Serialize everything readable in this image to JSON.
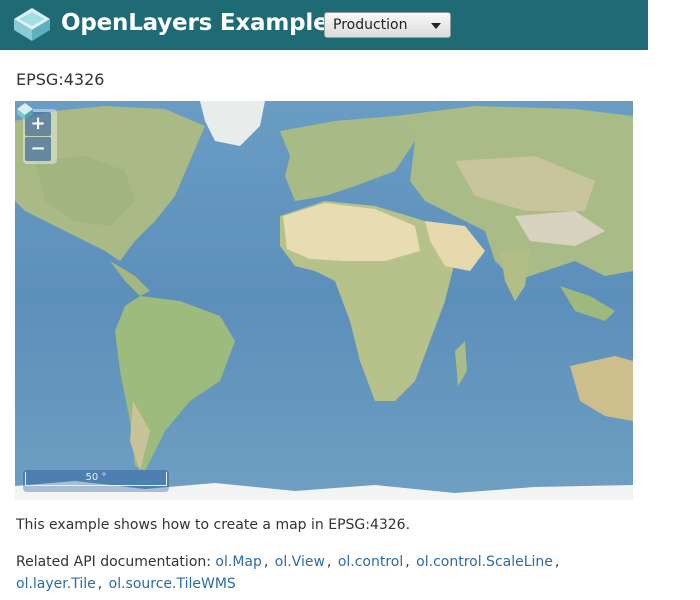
{
  "header": {
    "title": "OpenLayers Examples",
    "mode_select": {
      "value": "Production"
    },
    "colors": {
      "bar": "#1f6b75"
    }
  },
  "page": {
    "heading": "EPSG:4326",
    "description": "This example shows how to create a map in EPSG:4326.",
    "related_label": "Related API documentation:",
    "api_links": [
      "ol.Map",
      "ol.View",
      "ol.control",
      "ol.control.ScaleLine",
      "ol.layer.Tile",
      "ol.source.TileWMS"
    ],
    "separator": ","
  },
  "map": {
    "zoom_in_label": "+",
    "zoom_out_label": "−",
    "scale_label": "50 °",
    "colors": {
      "ocean": "#5a8fb6",
      "land": "#b9c48e",
      "desert": "#e8dfb7",
      "ice": "#f4f6f5"
    }
  }
}
